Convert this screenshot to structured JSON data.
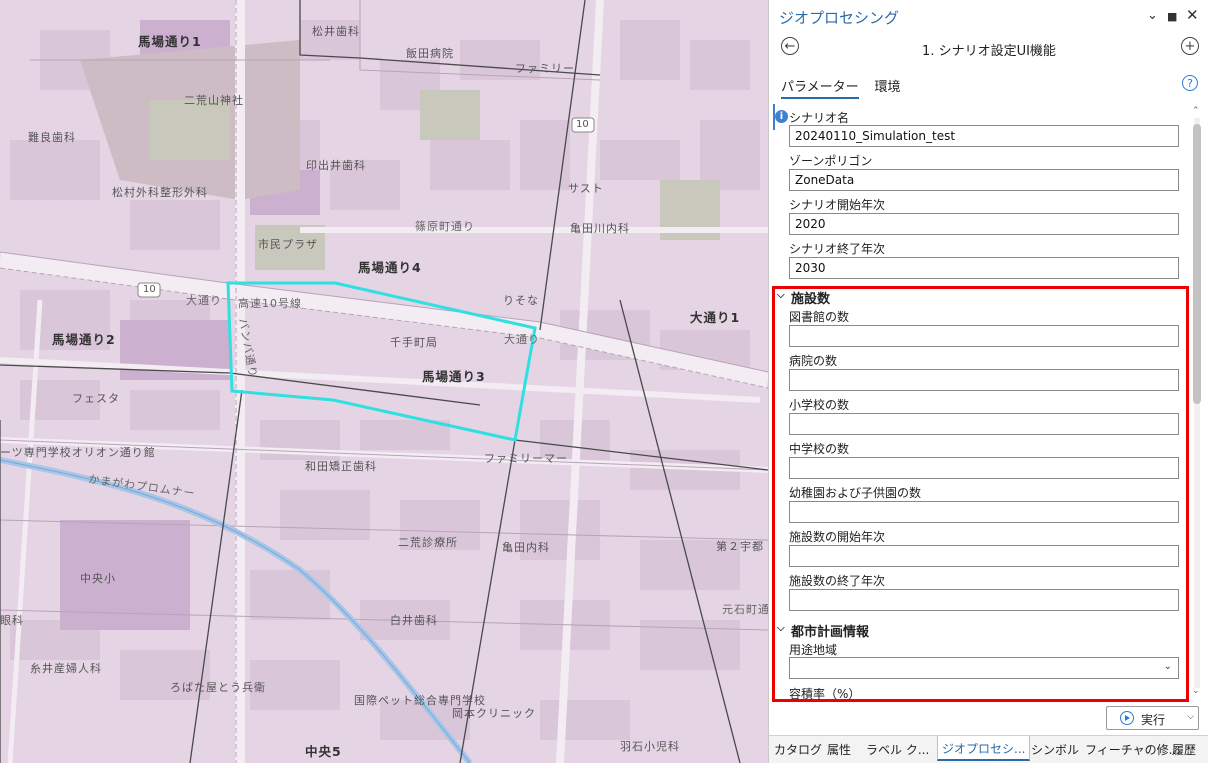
{
  "map": {
    "labels": [
      "馬場通り1",
      "松井歯科",
      "飯田病院",
      "ファミリー",
      "二荒山神社",
      "難良歯科",
      "印出井歯科",
      "松村外科整形外科",
      "サスト",
      "篠原町通り",
      "亀田川内科",
      "市民プラザ",
      "馬場通り4",
      "10",
      "大通り",
      "高速10号線",
      "りそな",
      "大通り1",
      "馬場通り2",
      "千手町局",
      "大通り",
      "馬場通り3",
      "フェスタ",
      "ーツ専門学校オリオン通り館",
      "和田矯正歯科",
      "ファミリーマー",
      "かまがわプロムナー",
      "二荒診療所",
      "亀田内科",
      "第２宇都",
      "中央小",
      "白井歯科",
      "眼科",
      "糸井産婦人科",
      "ろばた屋とう兵衛",
      "国際ペット総合専門学校",
      "岡本クリニック",
      "羽石小児科",
      "中央5",
      "元石町通",
      "10",
      "バンバ通り"
    ]
  },
  "pane": {
    "title": "ジオプロセシング",
    "tool_title": "1. シナリオ設定UI機能",
    "tabs": [
      "パラメーター",
      "環境"
    ],
    "help": "?",
    "info": "i",
    "fields_top": [
      {
        "label": "シナリオ名",
        "value": "20240110_Simulation_test"
      },
      {
        "label": "ゾーンポリゴン",
        "value": "ZoneData"
      },
      {
        "label": "シナリオ開始年次",
        "value": "2020"
      },
      {
        "label": "シナリオ終了年次",
        "value": "2030"
      }
    ],
    "group1": {
      "title": "施設数",
      "fields": [
        {
          "label": "図書館の数",
          "value": ""
        },
        {
          "label": "病院の数",
          "value": ""
        },
        {
          "label": "小学校の数",
          "value": ""
        },
        {
          "label": "中学校の数",
          "value": ""
        },
        {
          "label": "幼稚園および子供園の数",
          "value": ""
        },
        {
          "label": "施設数の開始年次",
          "value": ""
        },
        {
          "label": "施設数の終了年次",
          "value": ""
        }
      ]
    },
    "group2": {
      "title": "都市計画情報",
      "fields": [
        {
          "label": "用途地域",
          "value": ""
        },
        {
          "label": "容積率（%）",
          "value": ""
        }
      ]
    },
    "run_label": "実行",
    "bottom_tabs": [
      "カタログ",
      "属性",
      "ラベル ク...",
      "ジオプロセシ...",
      "シンボル",
      "フィーチャの修...",
      "履歴"
    ]
  },
  "colors": {
    "accent": "#2b6aa8",
    "highlight_polygon": "#2ee0e0",
    "red_box": "#e00000",
    "map_bg": "#e4d4e4"
  }
}
